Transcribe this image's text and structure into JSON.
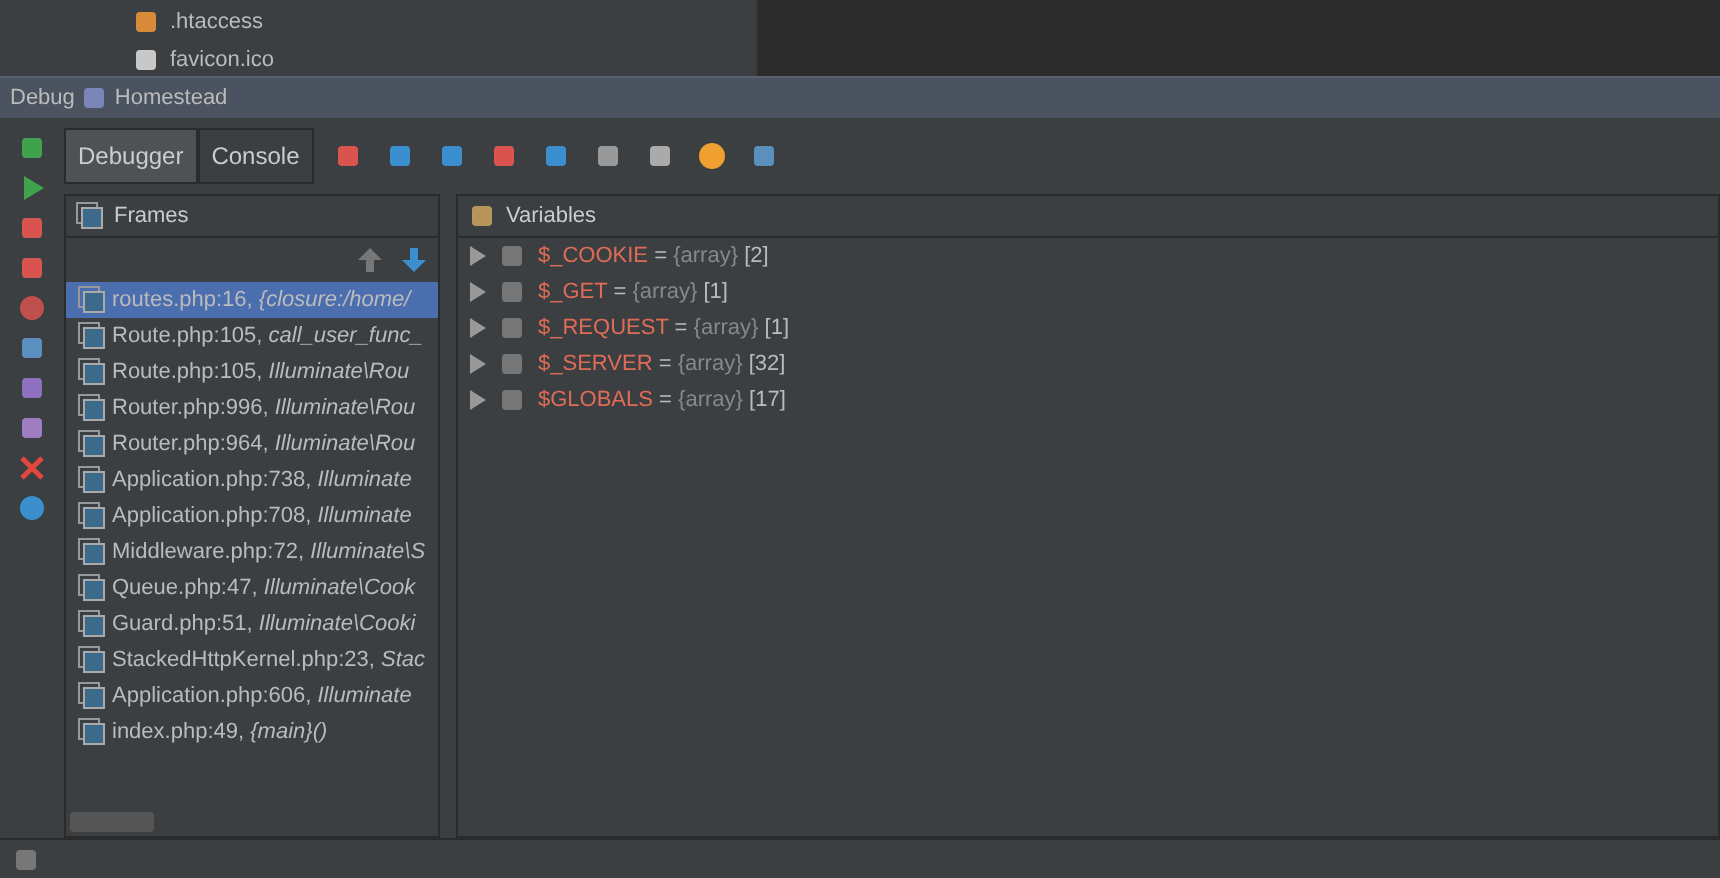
{
  "file_tree": [
    {
      "name": ".htaccess",
      "kind": "htaccess"
    },
    {
      "name": "favicon.ico",
      "kind": "ico"
    }
  ],
  "debug_bar": {
    "label": "Debug",
    "config": "Homestead"
  },
  "tabs": [
    {
      "label": "Debugger",
      "selected": true
    },
    {
      "label": "Console",
      "selected": false
    }
  ],
  "frames": {
    "title": "Frames",
    "items": [
      {
        "file": "routes.php:16, ",
        "method": "{closure:/home/",
        "selected": true
      },
      {
        "file": "Route.php:105, ",
        "method": "call_user_func_",
        "selected": false
      },
      {
        "file": "Route.php:105, ",
        "method": "Illuminate\\Rou",
        "selected": false
      },
      {
        "file": "Router.php:996, ",
        "method": "Illuminate\\Rou",
        "selected": false
      },
      {
        "file": "Router.php:964, ",
        "method": "Illuminate\\Rou",
        "selected": false
      },
      {
        "file": "Application.php:738, ",
        "method": "Illuminate",
        "selected": false
      },
      {
        "file": "Application.php:708, ",
        "method": "Illuminate",
        "selected": false
      },
      {
        "file": "Middleware.php:72, ",
        "method": "Illuminate\\S",
        "selected": false
      },
      {
        "file": "Queue.php:47, ",
        "method": "Illuminate\\Cook",
        "selected": false
      },
      {
        "file": "Guard.php:51, ",
        "method": "Illuminate\\Cooki",
        "selected": false
      },
      {
        "file": "StackedHttpKernel.php:23, ",
        "method": "Stac",
        "selected": false
      },
      {
        "file": "Application.php:606, ",
        "method": "Illuminate",
        "selected": false
      },
      {
        "file": "index.php:49, ",
        "method": "{main}()",
        "selected": false
      }
    ]
  },
  "variables": {
    "title": "Variables",
    "items": [
      {
        "name": "$_COOKIE",
        "sep": "=",
        "type": "{array}",
        "count": "[2]"
      },
      {
        "name": "$_GET",
        "sep": "=",
        "type": "{array}",
        "count": "[1]"
      },
      {
        "name": "$_REQUEST",
        "sep": "=",
        "type": "{array}",
        "count": "[1]"
      },
      {
        "name": "$_SERVER",
        "sep": "=",
        "type": "{array}",
        "count": "[32]"
      },
      {
        "name": "$GLOBALS",
        "sep": "=",
        "type": "{array}",
        "count": "[17]"
      }
    ]
  }
}
